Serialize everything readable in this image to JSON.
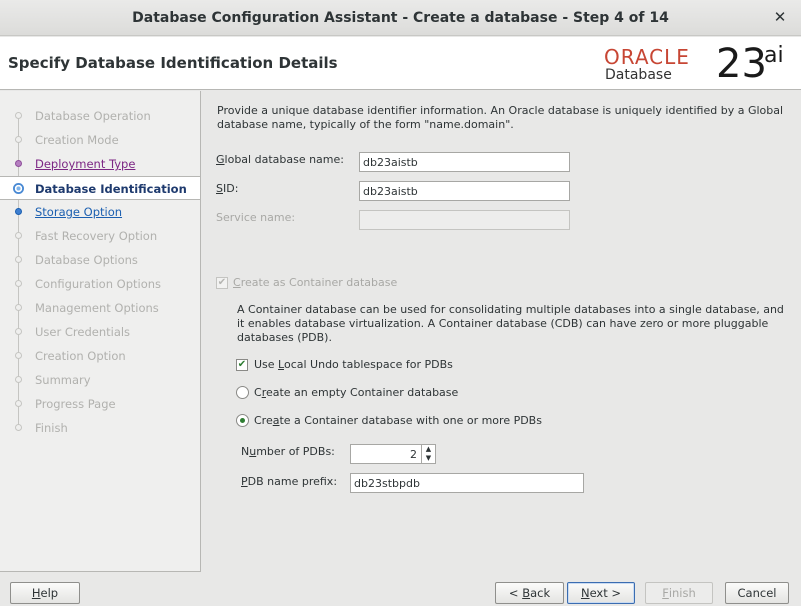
{
  "window": {
    "title": "Database Configuration Assistant - Create a database - Step 4 of 14",
    "close_glyph": "✕"
  },
  "header": {
    "page_title": "Specify Database Identification Details",
    "logo": {
      "brand": "ORACLE",
      "product": "Database",
      "version": "23",
      "suffix": "ai",
      "brand_color": "#c74634"
    }
  },
  "nav": {
    "items": [
      {
        "label": "Database Operation",
        "state": "disabled"
      },
      {
        "label": "Creation Mode",
        "state": "disabled"
      },
      {
        "label": "Deployment Type",
        "state": "done"
      },
      {
        "label": "Database Identification",
        "state": "current"
      },
      {
        "label": "Storage Option",
        "state": "next"
      },
      {
        "label": "Fast Recovery Option",
        "state": "disabled"
      },
      {
        "label": "Database Options",
        "state": "disabled"
      },
      {
        "label": "Configuration Options",
        "state": "disabled"
      },
      {
        "label": "Management Options",
        "state": "disabled"
      },
      {
        "label": "User Credentials",
        "state": "disabled"
      },
      {
        "label": "Creation Option",
        "state": "disabled"
      },
      {
        "label": "Summary",
        "state": "disabled"
      },
      {
        "label": "Progress Page",
        "state": "disabled"
      },
      {
        "label": "Finish",
        "state": "disabled"
      }
    ]
  },
  "content": {
    "intro": "Provide a unique database identifier information. An Oracle database is uniquely identified by a Global database name, typically of the form \"name.domain\".",
    "global_db_name": {
      "label_first": "G",
      "label_rest": "lobal database name:",
      "value": "db23aistb"
    },
    "sid": {
      "label_first": "S",
      "label_rest": "ID:",
      "value": "db23aistb"
    },
    "service_name": {
      "label": "Service name:",
      "value": ""
    },
    "container_db": {
      "label_first": "C",
      "label_rest": "reate as Container database",
      "checked": true,
      "enabled": false
    },
    "container_desc": "A Container database can be used for consolidating multiple databases into a single database, and it enables database virtualization. A Container database (CDB) can have zero or more pluggable databases (PDB).",
    "local_undo": {
      "label_before": "Use ",
      "label_ul": "L",
      "label_after": "ocal Undo tablespace for PDBs",
      "checked": true
    },
    "empty_cdb": {
      "label_before": "C",
      "label_ul": "r",
      "label_after": "eate an empty Container database",
      "selected": false
    },
    "cdb_with_pdbs": {
      "label_before": "Cre",
      "label_ul": "a",
      "label_after": "te a Container database with one or more PDBs",
      "selected": true
    },
    "num_pdbs": {
      "label_first": "N",
      "label_ul": "u",
      "label_rest": "mber of PDBs:",
      "value": "2"
    },
    "pdb_prefix": {
      "label_first": "P",
      "label_rest": "DB name prefix:",
      "value": "db23stbpdb"
    }
  },
  "buttons": {
    "help": {
      "ul": "H",
      "rest": "elp"
    },
    "back": {
      "before": "< ",
      "ul": "B",
      "rest": "ack"
    },
    "next": {
      "ul": "N",
      "rest": "ext >"
    },
    "finish": {
      "ul": "F",
      "rest": "inish"
    },
    "cancel": {
      "label": "Cancel"
    }
  }
}
